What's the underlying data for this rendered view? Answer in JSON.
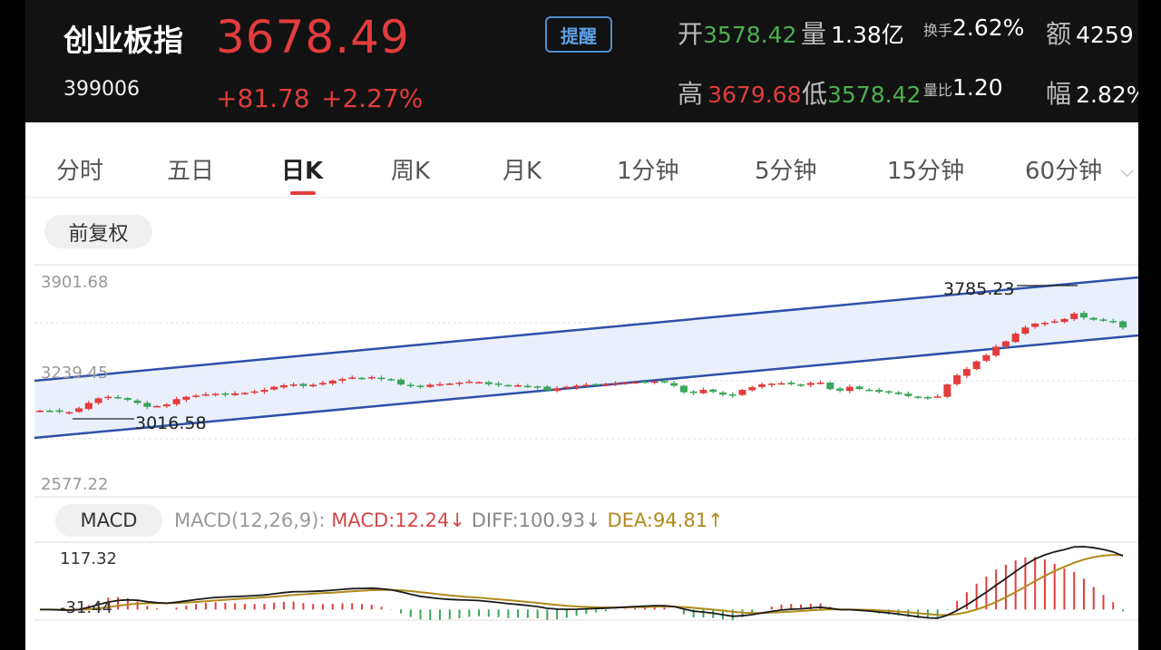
{
  "header": {
    "name": "创业板指",
    "code": "399006",
    "price": "3678.49",
    "change": "+81.78",
    "change_pct": "+2.27%",
    "remind_label": "提醒",
    "open_label": "开",
    "open_value": "3578.42",
    "volume_label": "量",
    "volume_value": "1.38亿",
    "turnover_label": "换手",
    "turnover_value": "2.62%",
    "amount_label": "额",
    "amount_value": "4259",
    "high_label": "高",
    "high_value": "3679.68",
    "low_label": "低",
    "low_value": "3578.42",
    "vol_ratio_label": "量比",
    "vol_ratio_value": "1.20",
    "amplitude_label": "幅",
    "amplitude_value": "2.82%"
  },
  "tabs": [
    {
      "label": "分时",
      "active": false
    },
    {
      "label": "五日",
      "active": false
    },
    {
      "label": "日K",
      "active": true
    },
    {
      "label": "周K",
      "active": false
    },
    {
      "label": "月K",
      "active": false
    },
    {
      "label": "1分钟",
      "active": false
    },
    {
      "label": "5分钟",
      "active": false
    },
    {
      "label": "15分钟",
      "active": false
    },
    {
      "label": "60分钟",
      "active": false
    }
  ],
  "adjust_label": "前复权",
  "kline": {
    "y_labels": [
      "3901.68",
      "3239.45",
      "2577.22"
    ],
    "max_label": "3785.23",
    "min_label": "3016.58",
    "colors": {
      "up": "#e23c3c",
      "down": "#3aa55a",
      "channel": "#2f4fa8",
      "channel_fill": "#e9f0fb"
    }
  },
  "macd": {
    "pill": "MACD",
    "params": "MACD(12,26,9):",
    "macd": "MACD:12.24↓",
    "diff": "DIFF:100.93↓",
    "dea": "DEA:94.81↑",
    "y_top": "117.32",
    "y_bottom": "-31.44"
  },
  "chart_data": {
    "type": "candlestick",
    "ylim": [
      2577.22,
      3901.68
    ],
    "annotations": {
      "max": 3785.23,
      "min": 3016.58
    },
    "approx_closes": [
      3060,
      3058,
      3052,
      3050,
      3075,
      3110,
      3140,
      3150,
      3140,
      3130,
      3110,
      3085,
      3090,
      3100,
      3135,
      3150,
      3158,
      3166,
      3170,
      3165,
      3172,
      3175,
      3185,
      3195,
      3215,
      3225,
      3230,
      3220,
      3228,
      3240,
      3255,
      3265,
      3275,
      3270,
      3278,
      3265,
      3258,
      3230,
      3220,
      3218,
      3228,
      3232,
      3236,
      3242,
      3248,
      3245,
      3232,
      3228,
      3220,
      3225,
      3218,
      3212,
      3190,
      3205,
      3215,
      3222,
      3228,
      3230,
      3232,
      3238,
      3242,
      3245,
      3248,
      3250,
      3243,
      3222,
      3180,
      3175,
      3195,
      3182,
      3165,
      3158,
      3195,
      3212,
      3230,
      3235,
      3238,
      3232,
      3225,
      3240,
      3242,
      3200,
      3190,
      3215,
      3200,
      3195,
      3182,
      3180,
      3168,
      3155,
      3148,
      3145,
      3152,
      3230,
      3290,
      3330,
      3380,
      3420,
      3475,
      3510,
      3560,
      3600,
      3625,
      3630,
      3640,
      3655,
      3690,
      3665,
      3650,
      3646,
      3640,
      3600
    ],
    "macd": {
      "dif_range": [
        -31.44,
        117.32
      ],
      "last": {
        "MACD": 12.24,
        "DIFF": 100.93,
        "DEA": 94.81
      }
    }
  }
}
